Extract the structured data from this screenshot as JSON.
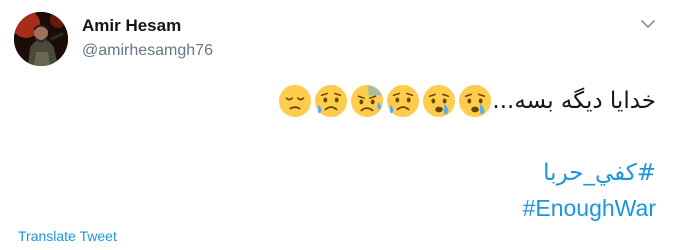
{
  "user": {
    "display_name": "Amir Hesam",
    "handle": "@amirhesamgh76"
  },
  "tweet": {
    "text": "خدایا دیگه بسه...",
    "emojis": [
      "pensive-face-icon",
      "sad-but-relieved-face-icon",
      "anxious-face-with-sweat-icon",
      "sad-but-relieved-face-icon",
      "crying-face-icon",
      "crying-face-icon"
    ],
    "hashtags": {
      "arabic": "#كفي_حربا",
      "english": "#EnoughWar"
    }
  },
  "actions": {
    "translate_label": "Translate Tweet",
    "menu_icon": "chevron-down-icon"
  },
  "colors": {
    "link": "#1b95e0",
    "text": "#14171a",
    "secondary": "#657786",
    "emoji_face": "#ffcc4d",
    "tear": "#5dadec"
  }
}
